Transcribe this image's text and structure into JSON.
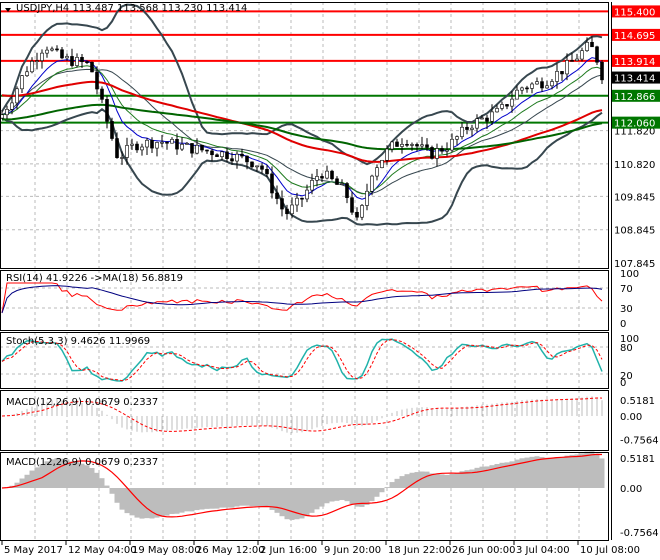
{
  "header": {
    "symbol_line": "USDJPY,H4  113.487 113.568 113.230 113.414"
  },
  "colors": {
    "up": "#000000",
    "down": "#000000",
    "bb": "#37474f",
    "ma_fast": "#0000cc",
    "ma_mid": "#1e7a1e",
    "ma_red": "#e00000",
    "ma_green": "#006400",
    "level_red": "#ff0000",
    "level_green": "#007700",
    "rsi": "#ff0000",
    "rsi_ma": "#000080",
    "stoch_main": "#20b2aa",
    "stoch_signal": "#ff0000",
    "hist": "#bdbdbd"
  },
  "chart_data": {
    "type": "candlestick",
    "price_axis": [
      "115.400",
      "114.695",
      "113.914",
      "113.414",
      "112.866",
      "112.060",
      "111.820",
      "110.820",
      "109.845",
      "108.845",
      "107.845"
    ],
    "ylim": [
      107.845,
      115.6
    ],
    "close_keypoints": [
      [
        0,
        112.2
      ],
      [
        12,
        112.8
      ],
      [
        25,
        113.6
      ],
      [
        45,
        114.4
      ],
      [
        60,
        114.0
      ],
      [
        90,
        113.8
      ],
      [
        105,
        112.3
      ],
      [
        118,
        111.0
      ],
      [
        135,
        111.4
      ],
      [
        160,
        111.5
      ],
      [
        190,
        111.3
      ],
      [
        230,
        111.1
      ],
      [
        260,
        110.8
      ],
      [
        285,
        109.3
      ],
      [
        300,
        109.7
      ],
      [
        320,
        110.6
      ],
      [
        345,
        110.0
      ],
      [
        358,
        109.0
      ],
      [
        372,
        110.6
      ],
      [
        390,
        111.3
      ],
      [
        405,
        111.6
      ],
      [
        430,
        111.1
      ],
      [
        450,
        111.4
      ],
      [
        470,
        112.0
      ],
      [
        500,
        112.4
      ],
      [
        520,
        113.1
      ],
      [
        545,
        113.3
      ],
      [
        565,
        113.7
      ],
      [
        590,
        114.4
      ],
      [
        598,
        113.9
      ],
      [
        603,
        113.4
      ]
    ],
    "levels": [
      {
        "price": 115.4,
        "label": "115.400",
        "kind": "red"
      },
      {
        "price": 114.695,
        "label": "114.695",
        "kind": "red"
      },
      {
        "price": 113.914,
        "label": "113.914",
        "kind": "red"
      },
      {
        "price": 112.866,
        "label": "112.866",
        "kind": "green"
      },
      {
        "price": 112.06,
        "label": "112.060",
        "kind": "green"
      }
    ],
    "current_price": {
      "price": 113.414,
      "label": "113.414"
    },
    "x_labels": [
      "5 May 2017",
      "12 May 04:00",
      "19 May 08:00",
      "26 May 12:00",
      "2 Jun 16:00",
      "9 Jun 20:00",
      "18 Jun 22:00",
      "26 Jun 00:00",
      "3 Jul 04:00",
      "10 Jul 08:00"
    ]
  },
  "indicators": {
    "rsi": {
      "label": "RSI(14) 41.9226  ->MA(18) 56.8819",
      "scale": [
        "100",
        "70",
        "30",
        "0"
      ]
    },
    "stoch": {
      "label": "Stoch(5,3,3) 9.4626 11.9969",
      "scale": [
        "100",
        "80",
        "20",
        "0"
      ]
    },
    "macd1": {
      "label": "MACD(12,26,9) 0.0679 0.2337",
      "scale": [
        "0.5181",
        "0.00",
        "-0.7564"
      ]
    },
    "macd2": {
      "label": "MACD(12,26,9) 0.0679 0.2337",
      "scale": [
        "0.5181",
        "0.00",
        "-0.7564"
      ]
    }
  }
}
